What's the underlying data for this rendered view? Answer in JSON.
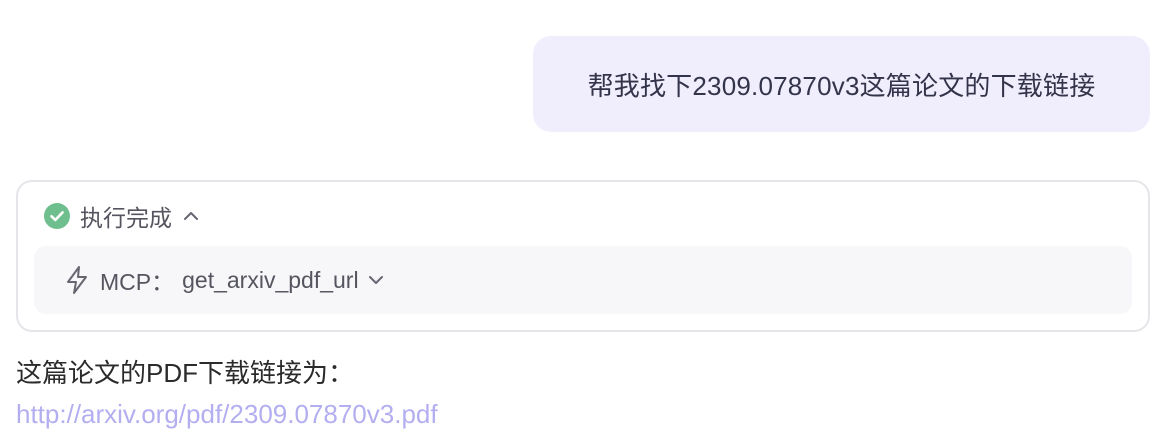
{
  "user_message": {
    "text": "帮我找下2309.07870v3这篇论文的下载链接"
  },
  "execution": {
    "status_label": "执行完成",
    "status_icon": "check-circle-icon",
    "expanded": true,
    "tool": {
      "prefix": "MCP：",
      "name": "get_arxiv_pdf_url",
      "icon": "bolt-icon",
      "expanded": false
    }
  },
  "assistant_message": {
    "text": "这篇论文的PDF下载链接为：",
    "link": "http://arxiv.org/pdf/2309.07870v3.pdf"
  },
  "colors": {
    "bubble_bg": "#f0eefc",
    "check_green": "#6fbf8e",
    "link": "#b3aef0",
    "tool_bg": "#f7f7f9"
  }
}
